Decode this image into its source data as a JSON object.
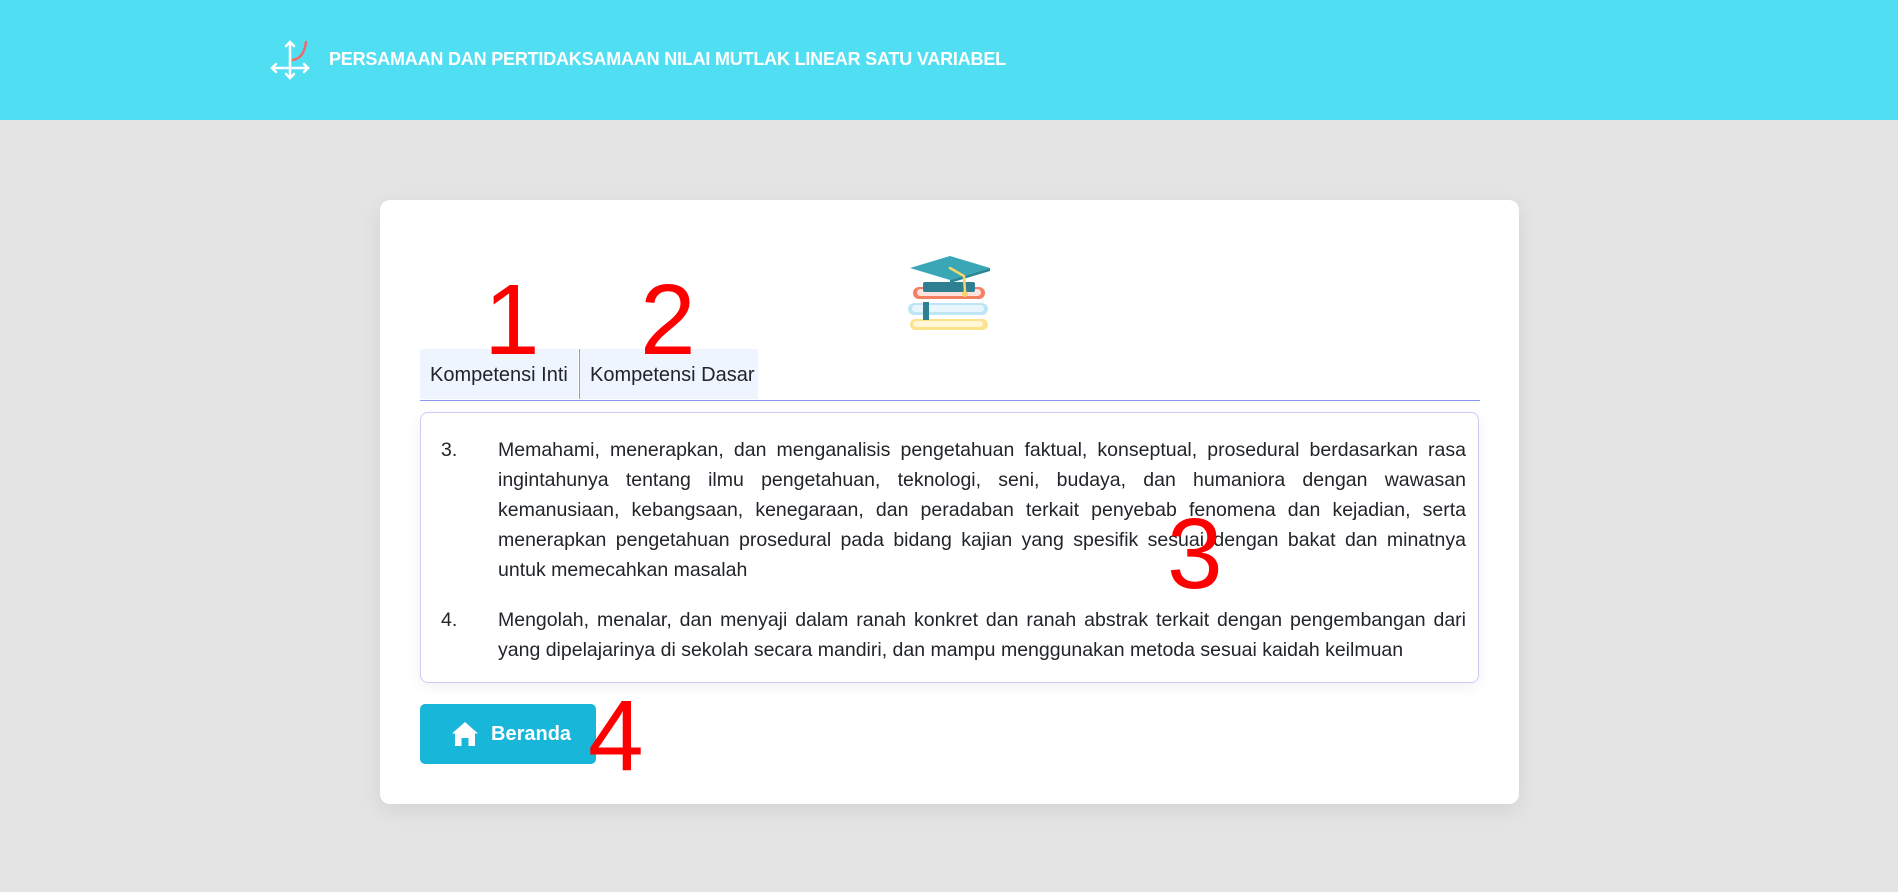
{
  "header": {
    "title": "PERSAMAAN DAN PERTIDAKSAMAAN NILAI MUTLAK LINEAR SATU VARIABEL",
    "logo_icon": "axes-curve-icon",
    "background_color": "#50dff2"
  },
  "card": {
    "illustration_icon": "graduation-cap-books-icon",
    "tabs": [
      {
        "label": "Kompetensi Inti"
      },
      {
        "label": "Kompetensi Dasar"
      }
    ],
    "items": [
      {
        "number": "3.",
        "text": "Memahami, menerapkan, dan menganalisis pengetahuan faktual, konseptual, prosedural berdasarkan rasa ingintahunya tentang ilmu pengetahuan, teknologi, seni, budaya, dan humaniora dengan wawasan kemanusiaan, kebangsaan, kenegaraan, dan peradaban terkait penyebab fenomena dan kejadian, serta menerapkan pengetahuan prosedural pada bidang kajian yang spesifik sesuai dengan bakat dan minatnya untuk memecahkan masalah"
      },
      {
        "number": "4.",
        "text": "Mengolah, menalar, dan menyaji dalam ranah konkret dan ranah abstrak terkait dengan pengembangan dari yang dipelajarinya di sekolah secara mandiri, dan mampu menggunakan metoda sesuai kaidah keilmuan"
      }
    ],
    "home_button": {
      "label": "Beranda",
      "icon": "home-icon",
      "color": "#18b6d8"
    }
  },
  "annotations": [
    "1",
    "2",
    "3",
    "4"
  ]
}
